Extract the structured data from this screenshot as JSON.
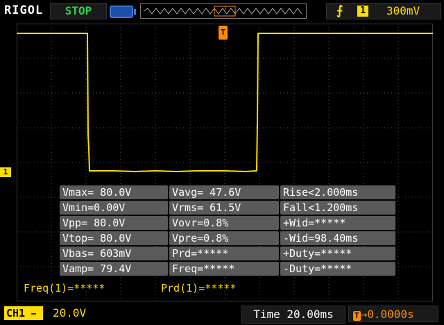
{
  "topbar": {
    "brand": "RIGOL",
    "status": "STOP",
    "trigger_channel": "1",
    "trigger_level": "300mV"
  },
  "channel_marker": "1",
  "trigger_marker": "T",
  "measurements": [
    [
      "Vmax= 80.0V",
      "Vavg= 47.6V",
      "Rise<2.000ms"
    ],
    [
      "Vmin=0.00V",
      "Vrms= 61.5V",
      "Fall<1.200ms"
    ],
    [
      "Vpp= 80.0V",
      "Vovr=0.8%",
      "+Wid=*****"
    ],
    [
      "Vtop= 80.0V",
      "Vpre=0.8%",
      "-Wid=98.40ms"
    ],
    [
      "Vbas= 603mV",
      "Prd=*****",
      "+Duty=*****"
    ],
    [
      "Vamp= 79.4V",
      "Freq=*****",
      "-Duty=*****"
    ]
  ],
  "counters": {
    "freq": "Freq(1)=*****",
    "prd": "Prd(1)=*****"
  },
  "bottombar": {
    "ch1_label": "CH1",
    "ch1_scale": "20.0V",
    "time": "Time 20.00ms",
    "offset": "0.0000s"
  },
  "colors": {
    "trace": "#ffdd00",
    "grid": "#666666",
    "trigger": "#ff8c00",
    "stop": "#2fd24d"
  }
}
